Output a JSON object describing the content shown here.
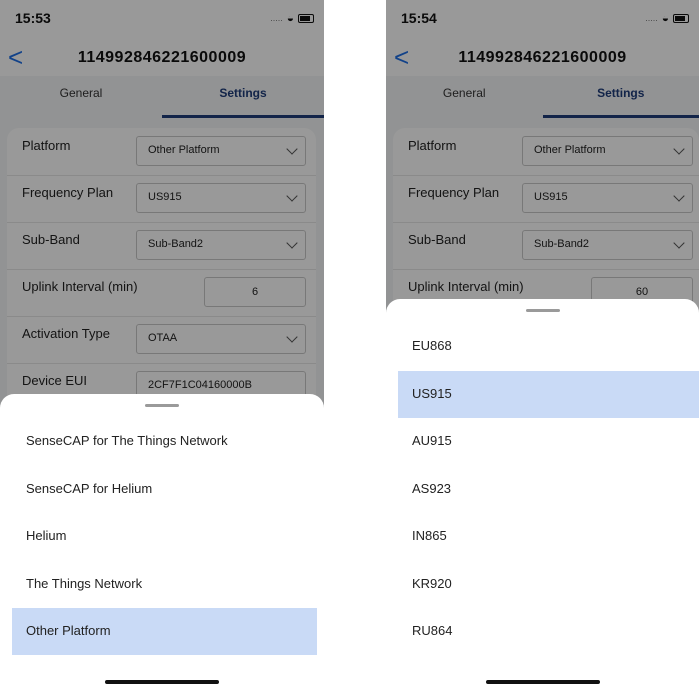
{
  "left": {
    "status": {
      "time": "15:53",
      "signal": "....."
    },
    "nav": {
      "back": "<",
      "title": "114992846221600009"
    },
    "tabs": [
      "General",
      "Settings"
    ],
    "rows": {
      "platform": {
        "label": "Platform",
        "value": "Other Platform"
      },
      "frequency": {
        "label": "Frequency Plan",
        "value": "US915"
      },
      "subband": {
        "label": "Sub-Band",
        "value": "Sub-Band2"
      },
      "uplink": {
        "label": "Uplink Interval (min)",
        "value": "6"
      },
      "activation": {
        "label": "Activation Type",
        "value": "OTAA"
      },
      "device_eui": {
        "label": "Device EUI",
        "value": "2CF7F1C04160000B"
      }
    },
    "sheet": {
      "options": [
        "SenseCAP for The Things Network",
        "SenseCAP for Helium",
        "Helium",
        "The Things Network",
        "Other Platform"
      ],
      "selected_index": 4
    }
  },
  "right": {
    "status": {
      "time": "15:54",
      "signal": "....."
    },
    "nav": {
      "back": "<",
      "title": "114992846221600009"
    },
    "tabs": [
      "General",
      "Settings"
    ],
    "rows": {
      "platform": {
        "label": "Platform",
        "value": "Other Platform"
      },
      "frequency": {
        "label": "Frequency Plan",
        "value": "US915"
      },
      "subband": {
        "label": "Sub-Band",
        "value": "Sub-Band2"
      },
      "uplink": {
        "label": "Uplink Interval (min)",
        "value": "60"
      }
    },
    "sheet": {
      "options": [
        "EU868",
        "US915",
        "AU915",
        "AS923",
        "IN865",
        "KR920",
        "RU864"
      ],
      "selected_index": 1
    }
  },
  "colors": {
    "accent": "#1f3d7a",
    "back_arrow": "#1f6fe5",
    "selected_option": "#c9daf6"
  }
}
